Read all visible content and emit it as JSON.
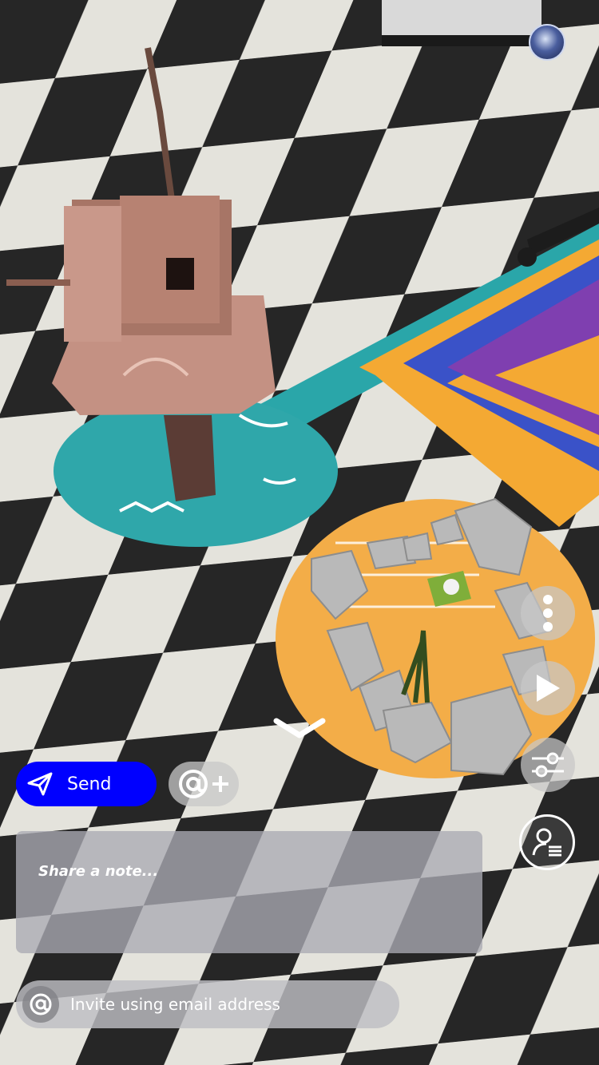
{
  "app": {
    "send_label": "Send",
    "note_placeholder": "Share a note...",
    "invite_label": "Invite using email address"
  },
  "icons": {
    "avatar": "user-avatar",
    "more": "more-vertical-icon",
    "play": "play-icon",
    "adjust": "sliders-icon",
    "profile": "profile-list-icon",
    "collapse": "chevron-down-icon",
    "send": "paper-plane-icon",
    "mention": "at-plus-icon",
    "invite": "at-icon"
  },
  "colors": {
    "send_button": "#0000ff",
    "overlay_gray": "#c8c8c8"
  }
}
